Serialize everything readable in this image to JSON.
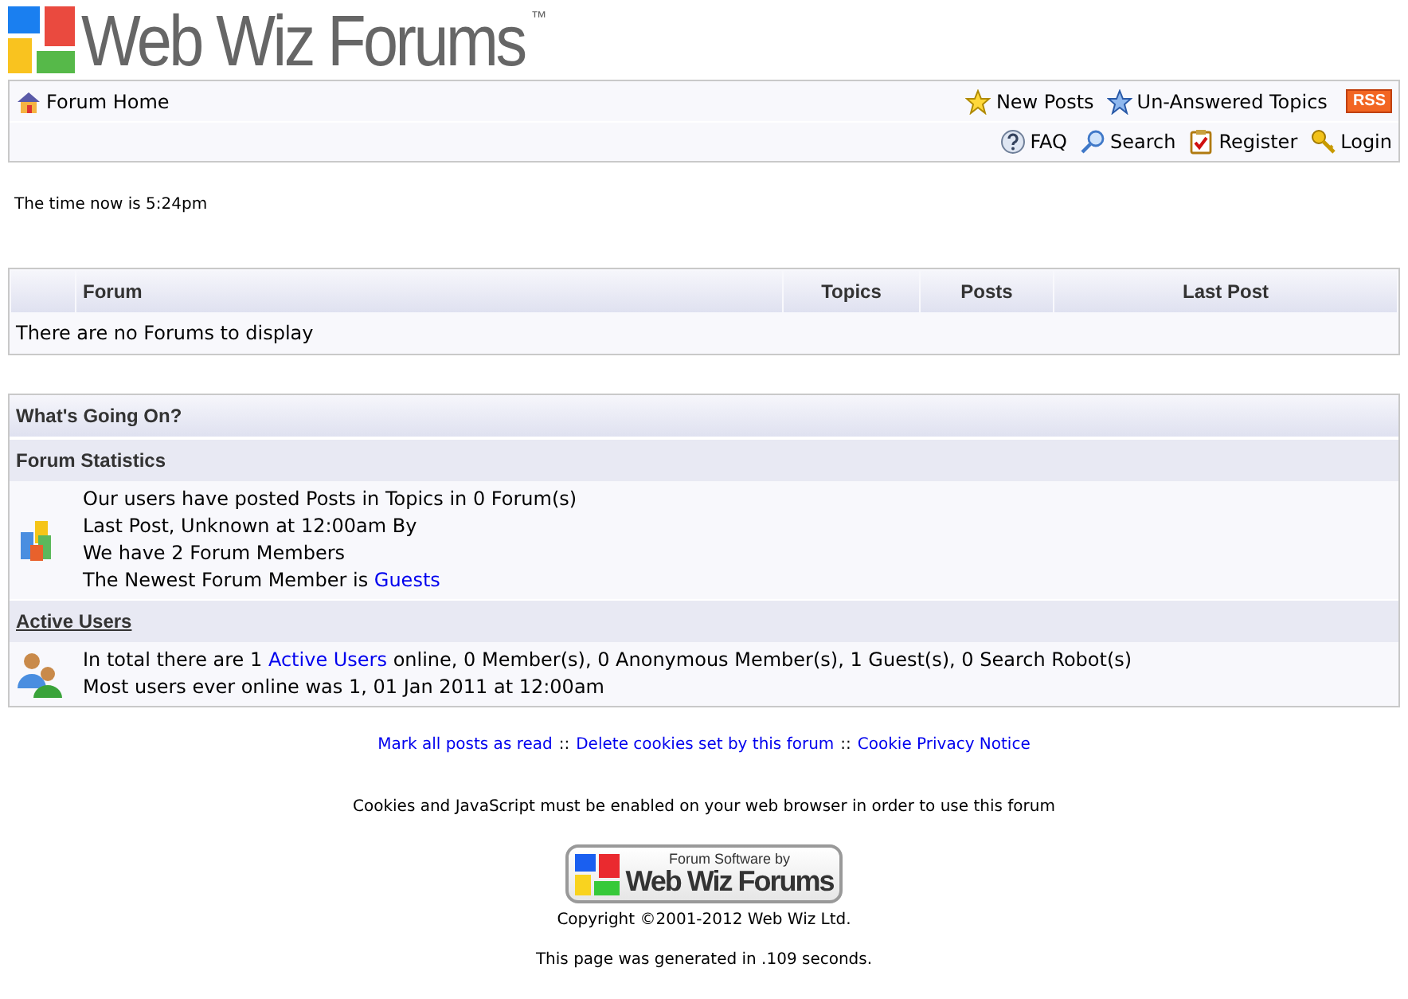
{
  "logo": {
    "title": "Web Wiz Forums",
    "trademark": "™"
  },
  "nav": {
    "home": "Forum Home",
    "top_links": [
      {
        "kind": "star-yellow",
        "label": "New Posts"
      },
      {
        "kind": "star-blue",
        "label": "Un-Answered Topics"
      },
      {
        "kind": "rss",
        "label": "RSS"
      }
    ],
    "bottom_links": [
      {
        "kind": "faq",
        "label": "FAQ"
      },
      {
        "kind": "search",
        "label": "Search"
      },
      {
        "kind": "register",
        "label": "Register"
      },
      {
        "kind": "login",
        "label": "Login"
      }
    ]
  },
  "time_note": "The time now is 5:24pm",
  "forum_table": {
    "columns": [
      "Forum",
      "Topics",
      "Posts",
      "Last Post"
    ],
    "empty_message": "There are no Forums to display"
  },
  "whats_going_on": {
    "title": "What's Going On?",
    "sections": [
      {
        "kind": "stats",
        "heading": "Forum Statistics",
        "heading_link": false,
        "lines": [
          [
            {
              "kind": "text",
              "text": "Our users have posted Posts in Topics in 0 Forum(s)"
            }
          ],
          [
            {
              "kind": "text",
              "text": "Last Post, Unknown at 12:00am By"
            }
          ],
          [
            {
              "kind": "text",
              "text": "We have 2 Forum Members"
            }
          ],
          [
            {
              "kind": "text",
              "text": "The Newest Forum Member is "
            },
            {
              "kind": "link",
              "text": "Guests"
            }
          ]
        ]
      },
      {
        "kind": "users",
        "heading": "Active Users",
        "heading_link": true,
        "lines": [
          [
            {
              "kind": "text",
              "text": "In total there are 1 "
            },
            {
              "kind": "link",
              "text": "Active Users"
            },
            {
              "kind": "text",
              "text": " online, 0 Member(s), 0 Anonymous Member(s), 1 Guest(s), 0 Search Robot(s)"
            }
          ],
          [
            {
              "kind": "text",
              "text": "Most users ever online was 1, 01 Jan 2011 at 12:00am"
            }
          ]
        ]
      }
    ]
  },
  "footer": {
    "links": [
      {
        "kind": "link",
        "text": "Mark all posts as read"
      },
      {
        "kind": "sep",
        "text": "::"
      },
      {
        "kind": "link",
        "text": "Delete cookies set by this forum"
      },
      {
        "kind": "sep",
        "text": "::"
      },
      {
        "kind": "link",
        "text": "Cookie Privacy Notice"
      }
    ],
    "notice": "Cookies and JavaScript must be enabled on your web browser in order to use this forum",
    "badge": {
      "caption": "Forum Software by",
      "title": "Web Wiz Forums"
    },
    "copyright": "Copyright ©2001-2012 Web Wiz Ltd.",
    "generated": "This page was generated in .109 seconds."
  }
}
